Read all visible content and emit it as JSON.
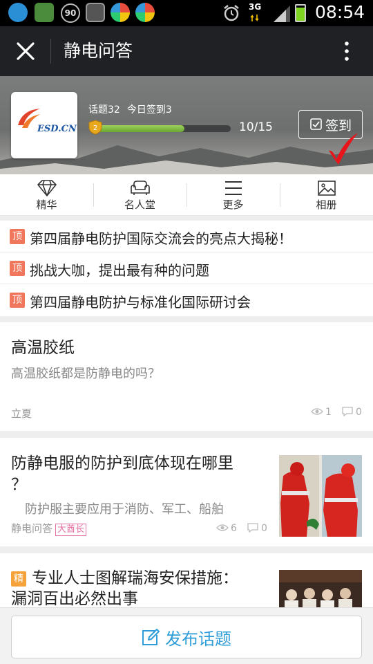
{
  "status_bar": {
    "time": "08:54",
    "network": "3G",
    "badge": "90"
  },
  "app_bar": {
    "title": "静电问答"
  },
  "header": {
    "logo_text": "ESD.CN",
    "topics_label": "话题32",
    "checkin_today_label": "今日签到3",
    "level": "2",
    "progress": {
      "current": 10,
      "total": 15,
      "text": "10/15"
    },
    "sign_button": "签到"
  },
  "tabs": [
    {
      "label": "精华",
      "icon": "diamond-icon"
    },
    {
      "label": "名人堂",
      "icon": "sofa-icon"
    },
    {
      "label": "更多",
      "icon": "menu-icon"
    },
    {
      "label": "相册",
      "icon": "photo-icon"
    }
  ],
  "pinned": {
    "tag": "顶",
    "items": [
      "第四届静电防护国际交流会的亮点大揭秘！",
      "挑战大咖，提出最有种的问题",
      "第四届静电防护与标准化国际研讨会"
    ]
  },
  "posts": [
    {
      "title": "高温胶纸",
      "excerpt": "高温胶纸都是防静电的吗？",
      "author": "立夏",
      "views": "1",
      "comments": "0"
    },
    {
      "title_line1": "防静电服的防护到底体现在哪里",
      "title_line2": "？",
      "excerpt": "防护服主要应用于消防、军工、船舶",
      "author": "静电问答",
      "author_tag": "大酋长",
      "views": "6",
      "comments": "0"
    },
    {
      "tag": "精",
      "title_line1": "专业人士图解瑞海安保措施：",
      "title_line2": "漏洞百出必然出事"
    }
  ],
  "bottom": {
    "publish_label": "发布话题"
  },
  "colors": {
    "accent": "#2f9ed8",
    "pin_tag": "#f0775c",
    "essence_tag": "#f6a23a",
    "progress": "#7fbf44",
    "appbar": "#1f2124"
  }
}
